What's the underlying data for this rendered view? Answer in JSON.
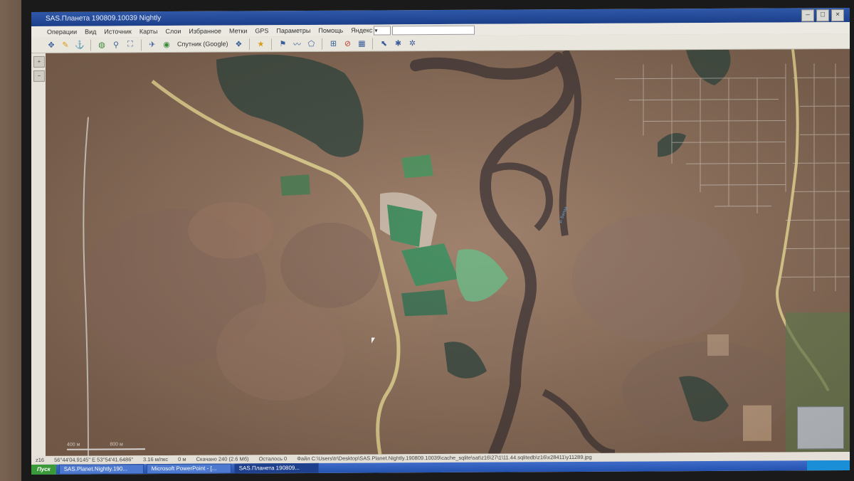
{
  "window": {
    "title": "SAS.Планета 190809.10039 Nightly"
  },
  "menu": {
    "items": [
      "Операции",
      "Вид",
      "Источник",
      "Карты",
      "Слои",
      "Избранное",
      "Метки",
      "GPS",
      "Параметры",
      "Помощь"
    ]
  },
  "search": {
    "provider": "Яндекс",
    "value": ""
  },
  "toolbar": {
    "layer_label": "Спутник (Google)"
  },
  "map": {
    "river_label": "р. Белая"
  },
  "scale": {
    "left": "400 м",
    "right": "800 м"
  },
  "status": {
    "zoom": "z16",
    "coords": "56°44'04.9145\" E 53°54'41.6486\"",
    "scale": "3.16 м/пкс",
    "distance": "0 м",
    "downloaded": "Скачано 240 (2.6 Мб)",
    "remaining": "Осталось 0",
    "file": "Файл C:\\Users\\tr\\Desktop\\SAS.Planet.Nightly.190809.10039\\cache_sqlite\\sat\\z16\\27\\1\\11.44.sqlitedb\\z16\\x28411\\y11289.jpg"
  },
  "taskbar": {
    "start": "Пуск",
    "tasks": [
      "SAS.Planet.Nightly.190...",
      "Microsoft PowerPoint - [...",
      "SAS.Планета 190809..."
    ]
  },
  "colors": {
    "title_bar": "#2f58a8",
    "toolbar": "#e9e6de",
    "map_base": "#8c6f5b",
    "river": "#4b3d39",
    "road": "#d9c98a",
    "pond": "#4f8f6a"
  }
}
